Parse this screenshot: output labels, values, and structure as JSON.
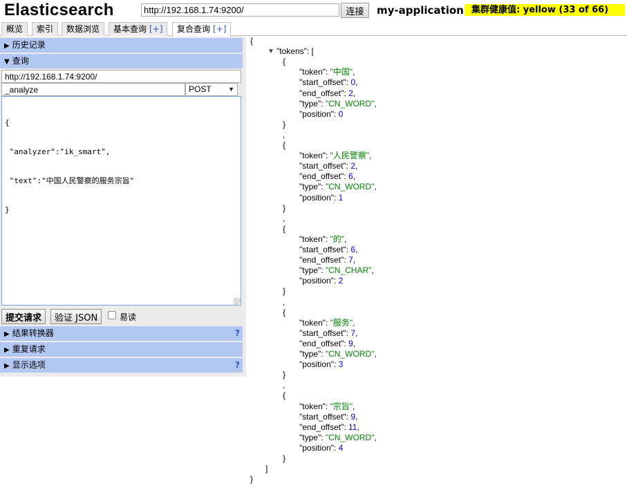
{
  "header": {
    "title": "Elasticsearch",
    "url": "http://192.168.1.74:9200/",
    "connect_label": "连接",
    "cluster_name": "my-application",
    "health": "集群健康值: yellow (33 of 66)"
  },
  "tabs": [
    {
      "label": "概览"
    },
    {
      "label": "索引"
    },
    {
      "label": "数据浏览"
    },
    {
      "label": "基本查询",
      "plus": "[+]"
    },
    {
      "label": "复合查询",
      "plus": "[+]",
      "active": true
    }
  ],
  "left": {
    "history_label": "历史记录",
    "query_label": "查询",
    "server_url": "http://192.168.1.74:9200/",
    "path": "_analyze",
    "method": "POST",
    "body_lines": [
      "{",
      " \"analyzer\":\"ik_smart\",",
      " \"text\":\"中国人民警察的服务宗旨\"",
      "}"
    ],
    "submit_label": "提交请求",
    "validate_label": "验证 JSON",
    "readonly_label": "易读",
    "sections": [
      {
        "label": "结果转换器",
        "help": "?"
      },
      {
        "label": "重复请求",
        "help": ""
      },
      {
        "label": "显示选项",
        "help": "?"
      }
    ]
  },
  "response": {
    "root_key": "tokens",
    "tokens": [
      {
        "token": "中国",
        "start_offset": "0",
        "end_offset": "2",
        "type": "CN_WORD",
        "position": "0"
      },
      {
        "token": "人民警察",
        "start_offset": "2",
        "end_offset": "6",
        "type": "CN_WORD",
        "position": "1"
      },
      {
        "token": "的",
        "start_offset": "6",
        "end_offset": "7",
        "type": "CN_CHAR",
        "position": "2"
      },
      {
        "token": "服务",
        "start_offset": "7",
        "end_offset": "9",
        "type": "CN_WORD",
        "position": "3"
      },
      {
        "token": "宗旨",
        "start_offset": "9",
        "end_offset": "11",
        "type": "CN_WORD",
        "position": "4"
      }
    ]
  }
}
